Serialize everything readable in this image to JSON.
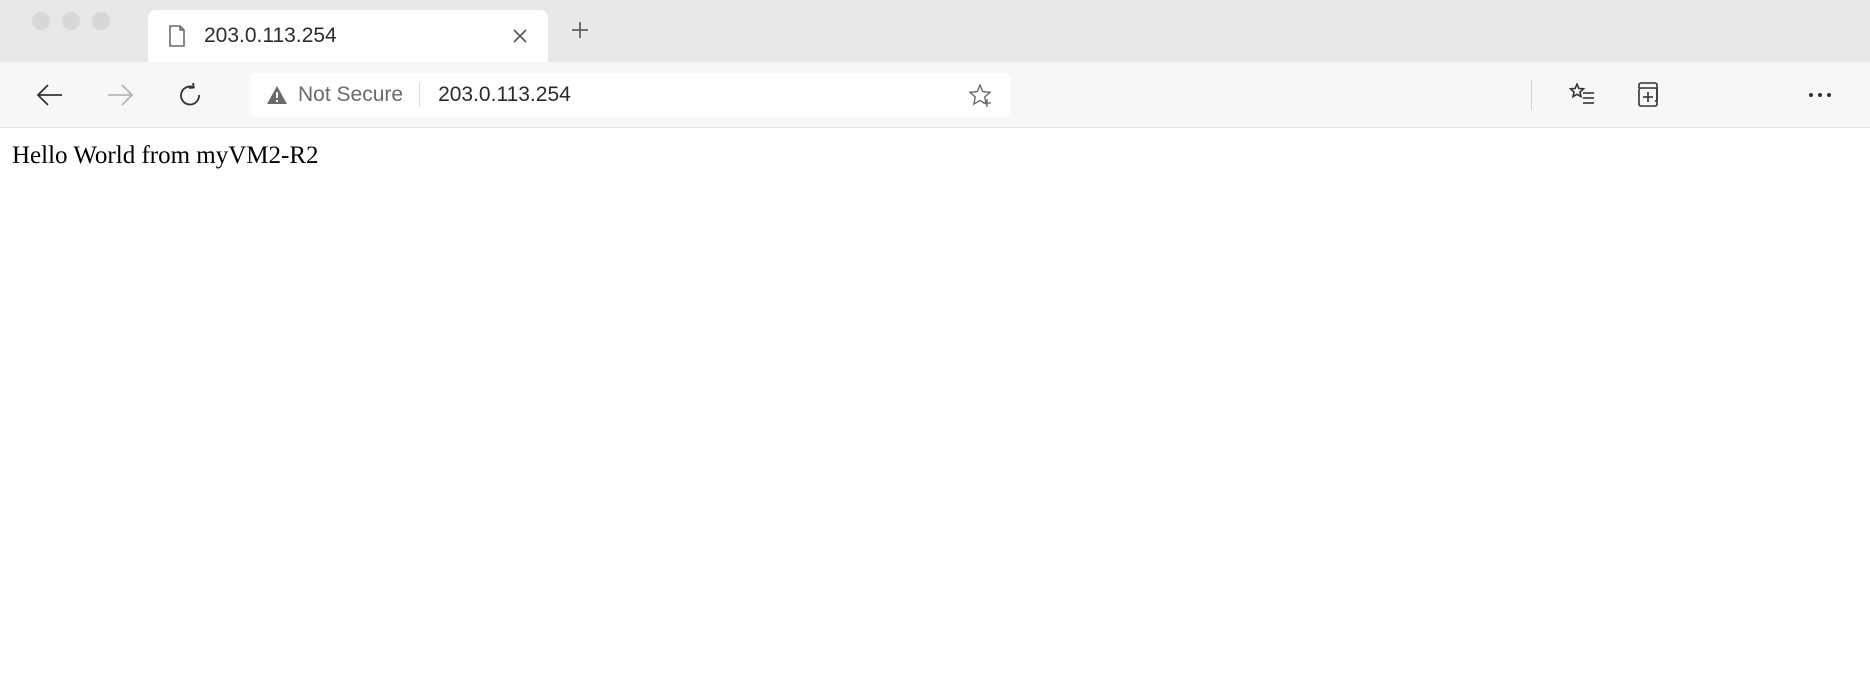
{
  "tab": {
    "title": "203.0.113.254"
  },
  "toolbar": {
    "security_label": "Not Secure",
    "url": "203.0.113.254"
  },
  "page": {
    "body_text": "Hello World from myVM2-R2"
  }
}
